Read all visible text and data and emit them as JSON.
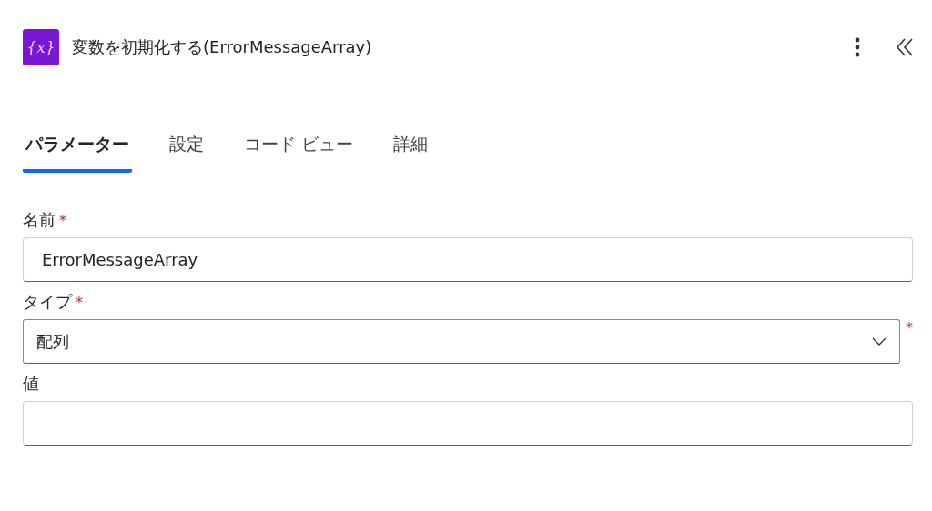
{
  "header": {
    "icon_label": "{x}",
    "title": "変数を初期化する(ErrorMessageArray)"
  },
  "tabs": [
    {
      "label": "パラメーター",
      "selected": true
    },
    {
      "label": "設定",
      "selected": false
    },
    {
      "label": "コード ビュー",
      "selected": false
    },
    {
      "label": "詳細",
      "selected": false
    }
  ],
  "fields": [
    {
      "kind": "text",
      "label": "名前",
      "required_mark": "*",
      "value": "ErrorMessageArray"
    },
    {
      "kind": "dropdown",
      "label": "タイプ",
      "required_mark": "*",
      "value": "配列",
      "side_mark": "*"
    },
    {
      "kind": "text",
      "label": "値"
    }
  ]
}
